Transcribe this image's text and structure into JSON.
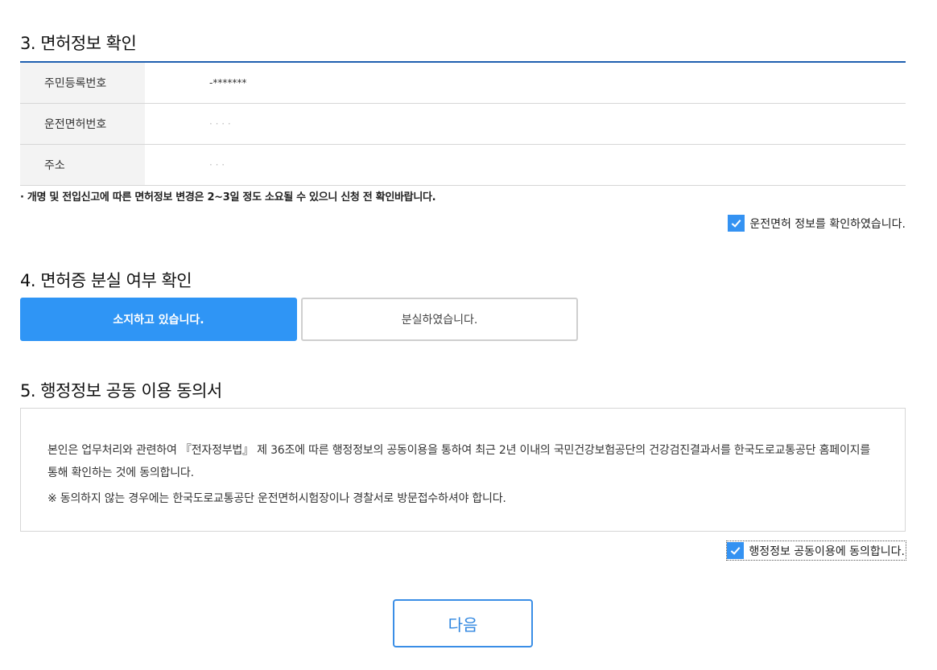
{
  "section3": {
    "title": "3. 면허정보 확인",
    "rows": [
      {
        "label": "주민등록번호",
        "value": "-*******"
      },
      {
        "label": "운전면허번호",
        "value": "· · · ·"
      },
      {
        "label": "주소",
        "value": "·  ·  ·"
      }
    ],
    "notice": "· 개명 및 전입신고에 따른 면허정보 변경은 2~3일 정도 소요될 수 있으니 신청 전 확인바랍니다.",
    "confirm_label": "운전면허 정보를 확인하였습니다."
  },
  "section4": {
    "title": "4. 면허증 분실 여부 확인",
    "options": [
      {
        "label": "소지하고 있습니다.",
        "selected": true
      },
      {
        "label": "분실하였습니다.",
        "selected": false
      }
    ]
  },
  "section5": {
    "title": "5. 행정정보 공동 이용 동의서",
    "body": "본인은 업무처리와 관련하여 『전자정부법』 제 36조에 따른 행정정보의 공동이용을 통하여 최근 2년 이내의 국민건강보험공단의 건강검진결과서를 한국도로교통공단 홈페이지를 통해 확인하는 것에 동의합니다.",
    "note": "※ 동의하지 않는 경우에는 한국도로교통공단 운전면허시험장이나 경찰서로 방문접수하셔야 합니다.",
    "agree_label": "행정정보 공동이용에 동의합니다."
  },
  "next_button": "다음",
  "colors": {
    "accent": "#2f95f5",
    "table_border": "#1f5fb0",
    "label_bg": "#f3f3f3"
  }
}
